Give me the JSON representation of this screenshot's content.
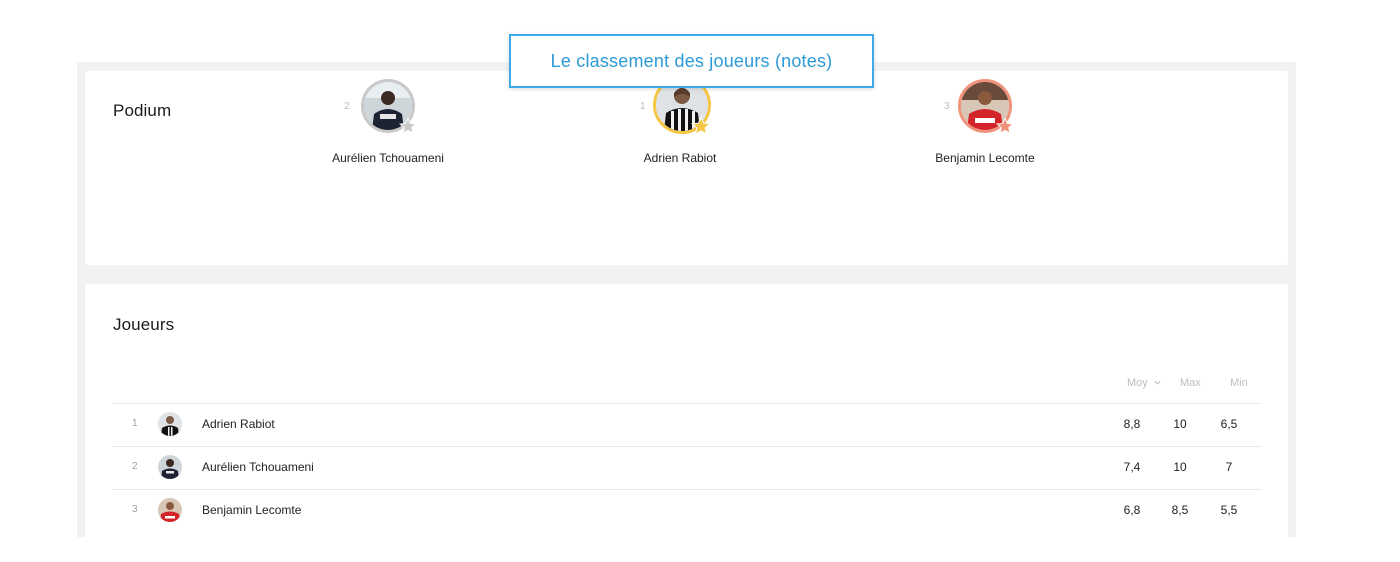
{
  "callout": {
    "text": "Le classement des joueurs (notes)"
  },
  "podium": {
    "title": "Podium",
    "entries": [
      {
        "rank": "2",
        "name": "Aurélien Tchouameni",
        "ring_color": "#c9c9c9",
        "star_color": "#c9c9c9",
        "icon": "star-icon"
      },
      {
        "rank": "1",
        "name": "Adrien Rabiot",
        "ring_color": "#f5c744",
        "star_color": "#f5c744",
        "icon": "star-icon"
      },
      {
        "rank": "3",
        "name": "Benjamin Lecomte",
        "ring_color": "#f0937a",
        "star_color": "#f0937a",
        "icon": "star-icon"
      }
    ]
  },
  "players": {
    "title": "Joueurs",
    "columns": {
      "moy": "Moy",
      "max": "Max",
      "min": "Min",
      "sort_icon": "chevron-down-icon"
    },
    "rows": [
      {
        "rank": "1",
        "name": "Adrien Rabiot",
        "moy": "8,8",
        "max": "10",
        "min": "6,5"
      },
      {
        "rank": "2",
        "name": "Aurélien Tchouameni",
        "moy": "7,4",
        "max": "10",
        "min": "7"
      },
      {
        "rank": "3",
        "name": "Benjamin Lecomte",
        "moy": "6,8",
        "max": "8,5",
        "min": "5,5"
      }
    ]
  },
  "colors": {
    "accent": "#3da9e6",
    "gold": "#f5c744",
    "silver": "#c9c9c9",
    "bronze": "#f0937a"
  }
}
